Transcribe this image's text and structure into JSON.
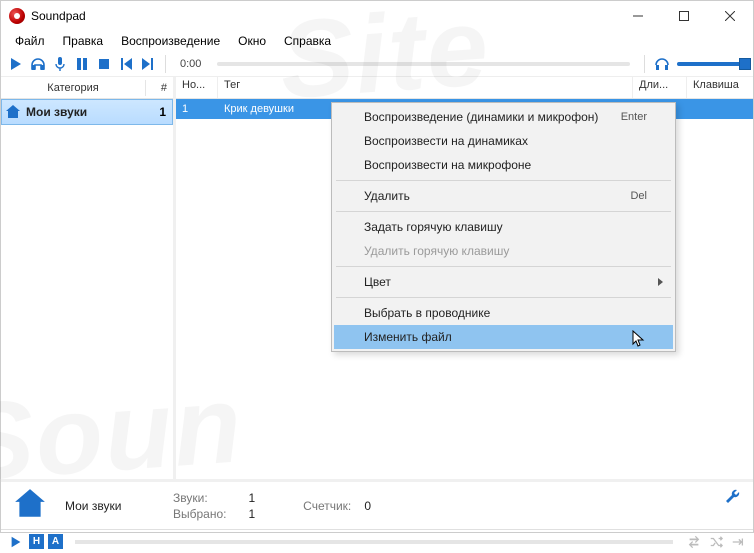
{
  "window": {
    "title": "Soundpad"
  },
  "menu": {
    "file": "Файл",
    "edit": "Правка",
    "playback": "Воспроизведение",
    "window": "Окно",
    "help": "Справка"
  },
  "toolbar": {
    "time": "0:00"
  },
  "sidebar": {
    "headers": {
      "category": "Категория",
      "count": "#"
    },
    "items": [
      {
        "label": "Мои звуки",
        "count": "1"
      }
    ]
  },
  "list": {
    "headers": {
      "no": "Но...",
      "tag": "Тег",
      "duration": "Дли...",
      "hotkey": "Клавиша"
    },
    "rows": [
      {
        "no": "1",
        "tag": "Крик девушки",
        "duration": "",
        "hotkey": ""
      }
    ]
  },
  "context_menu": {
    "play_both": "Воспроизведение (динамики и микрофон)",
    "play_speakers": "Воспроизвести на динамиках",
    "play_mic": "Воспроизвести на микрофоне",
    "delete": "Удалить",
    "set_hotkey": "Задать горячую клавишу",
    "remove_hotkey": "Удалить горячую клавишу",
    "color": "Цвет",
    "reveal": "Выбрать в проводнике",
    "change_file": "Изменить файл",
    "sc_enter": "Enter",
    "sc_del": "Del"
  },
  "footer": {
    "category": "Мои звуки",
    "sounds_label": "Звуки:",
    "sounds_value": "1",
    "selected_label": "Выбрано:",
    "selected_value": "1",
    "counter_label": "Счетчик:",
    "counter_value": "0"
  }
}
